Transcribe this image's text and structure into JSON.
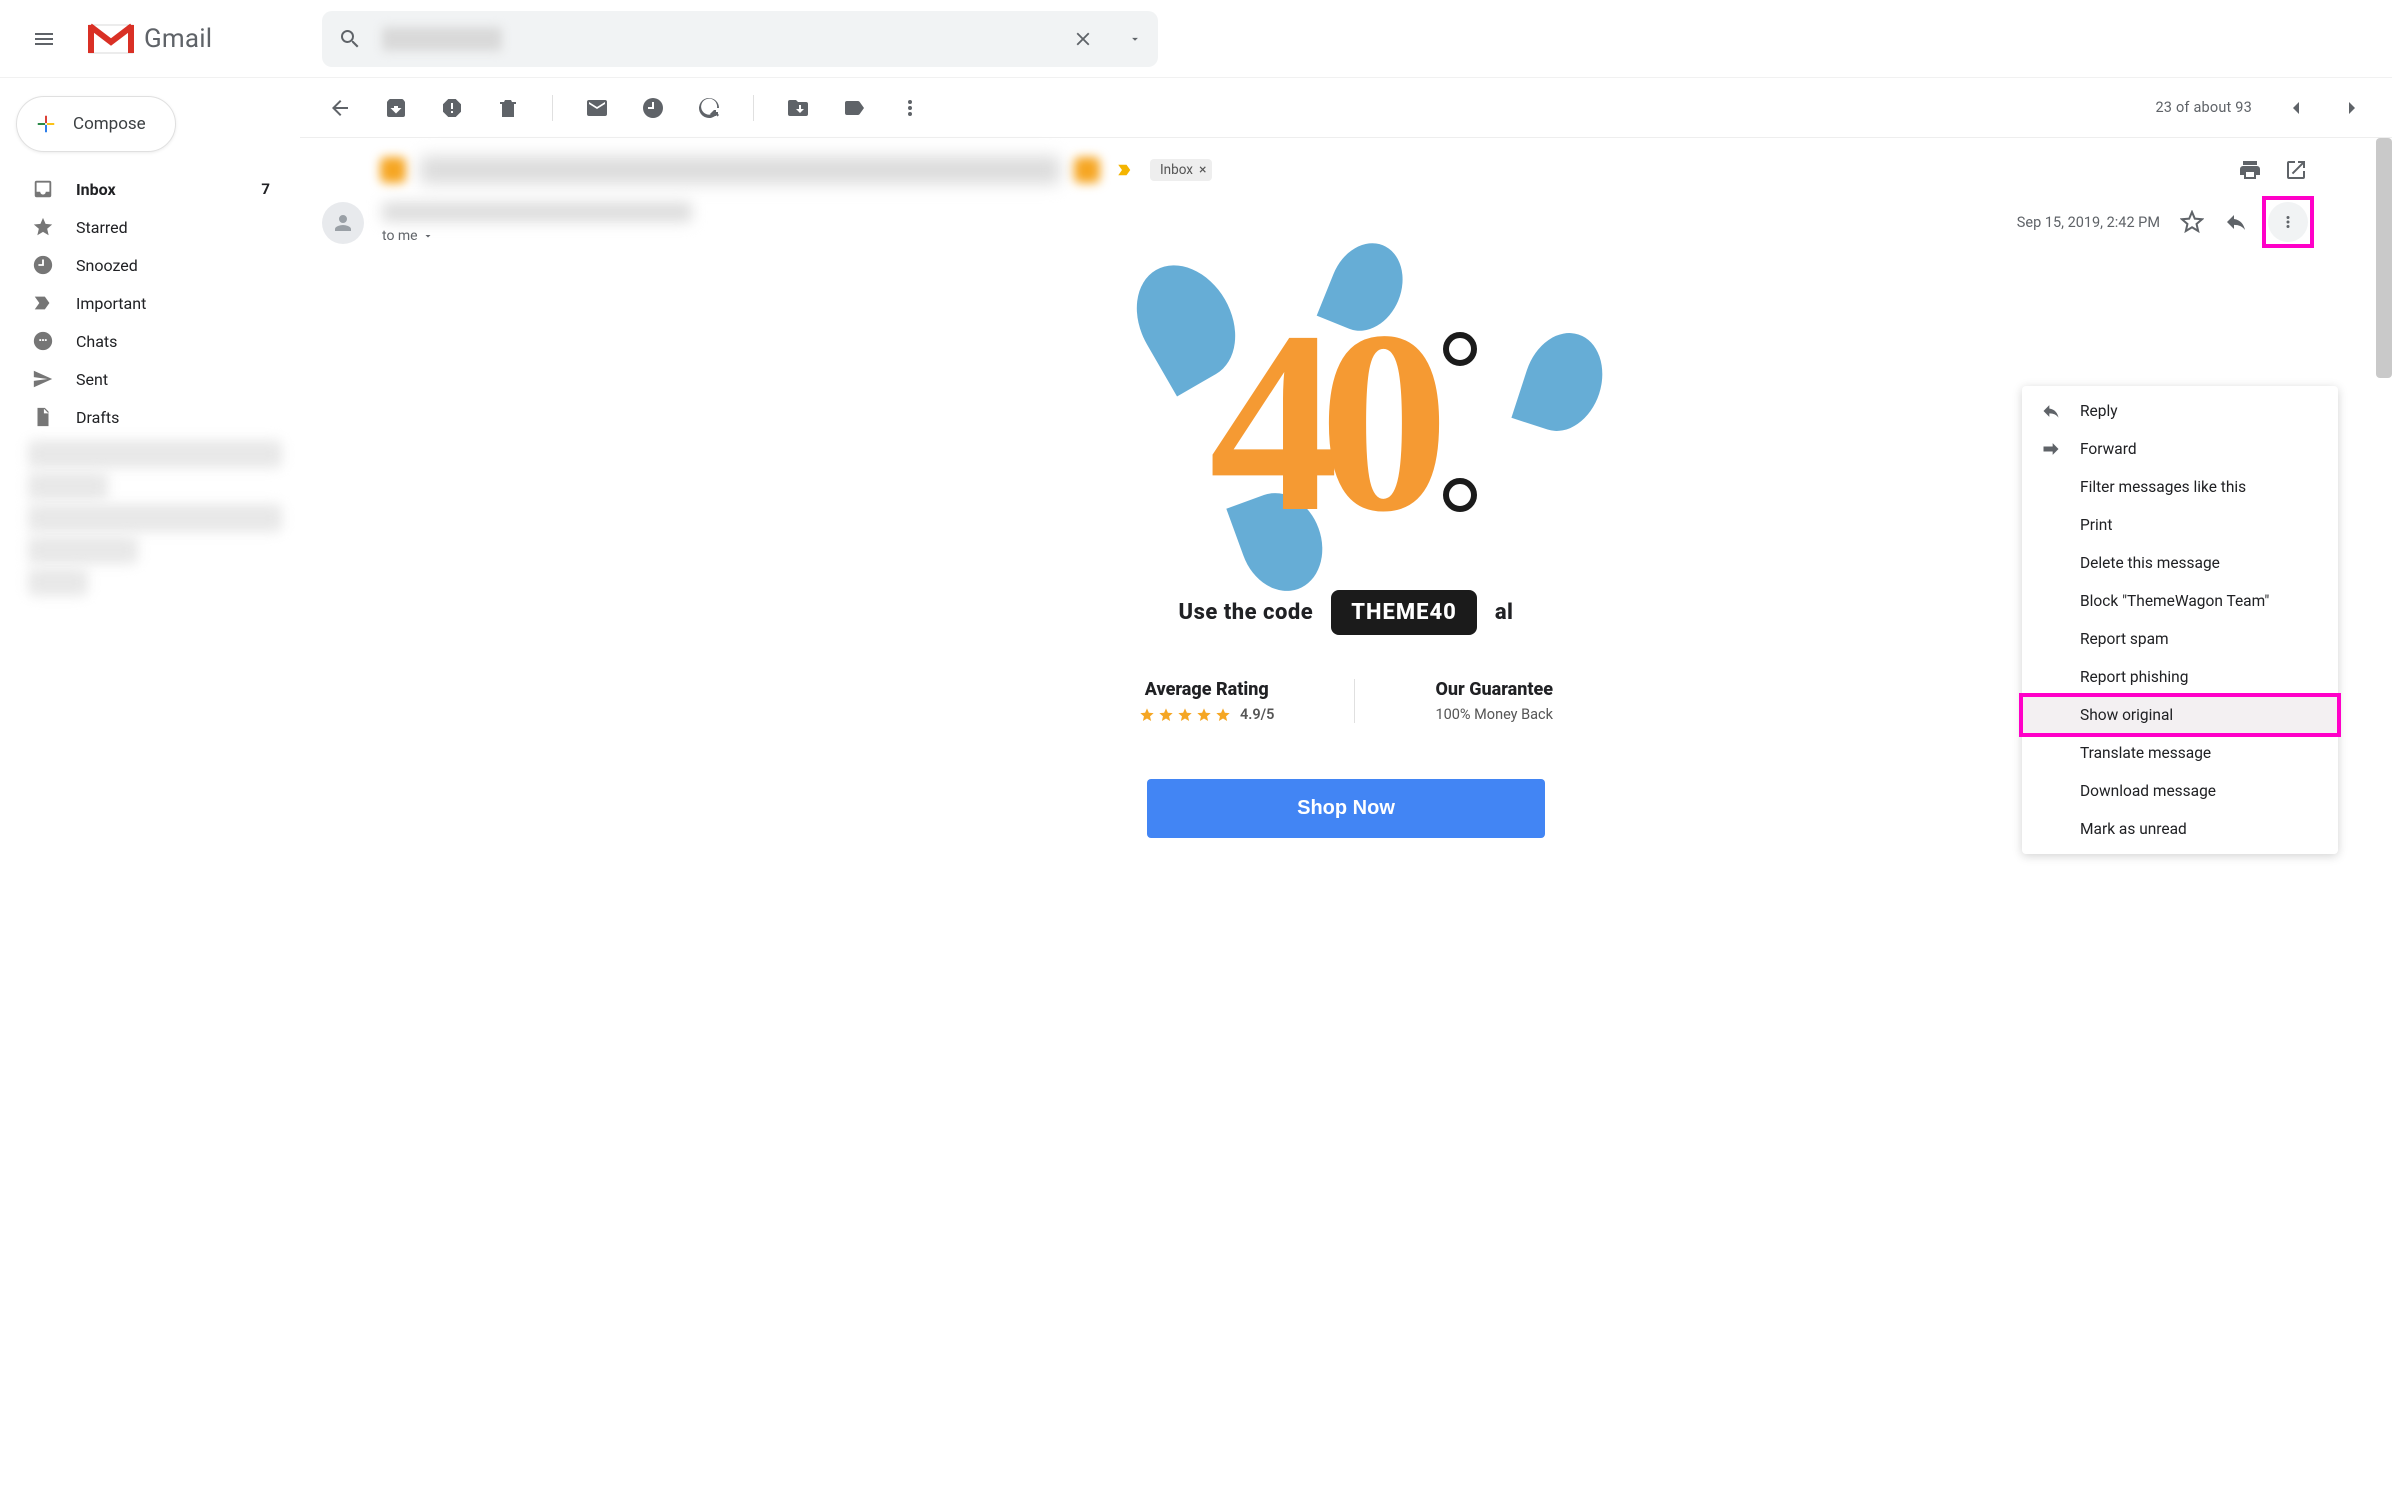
{
  "header": {
    "app_name": "Gmail"
  },
  "sidebar": {
    "compose_label": "Compose",
    "items": [
      {
        "label": "Inbox",
        "icon": "inbox-icon",
        "count": "7",
        "active": true
      },
      {
        "label": "Starred",
        "icon": "star-icon"
      },
      {
        "label": "Snoozed",
        "icon": "clock-icon"
      },
      {
        "label": "Important",
        "icon": "important-icon"
      },
      {
        "label": "Chats",
        "icon": "chat-icon"
      },
      {
        "label": "Sent",
        "icon": "sent-icon"
      },
      {
        "label": "Drafts",
        "icon": "draft-icon"
      }
    ]
  },
  "toolbar": {
    "pager_text": "23 of about 93"
  },
  "subject": {
    "chip_label": "Inbox"
  },
  "meta": {
    "date": "Sep 15, 2019, 2:42 PM",
    "to_line": "to me"
  },
  "menu": {
    "items": [
      {
        "label": "Reply",
        "icon": "reply-icon"
      },
      {
        "label": "Forward",
        "icon": "forward-icon"
      },
      {
        "label": "Filter messages like this"
      },
      {
        "label": "Print"
      },
      {
        "label": "Delete this message"
      },
      {
        "label": "Block \"ThemeWagon Team\""
      },
      {
        "label": "Report spam"
      },
      {
        "label": "Report phishing"
      },
      {
        "label": "Show original",
        "highlight": true
      },
      {
        "label": "Translate message"
      },
      {
        "label": "Download message"
      },
      {
        "label": "Mark as unread"
      }
    ]
  },
  "body": {
    "big_number": "40",
    "code_prefix": "Use the code",
    "code": "THEME40",
    "code_suffix": "al",
    "rating_heading": "Average Rating",
    "rating_value": "4.9/5",
    "guarantee_heading": "Our Guarantee",
    "guarantee_sub": "100% Money Back",
    "cta": "Shop Now"
  }
}
